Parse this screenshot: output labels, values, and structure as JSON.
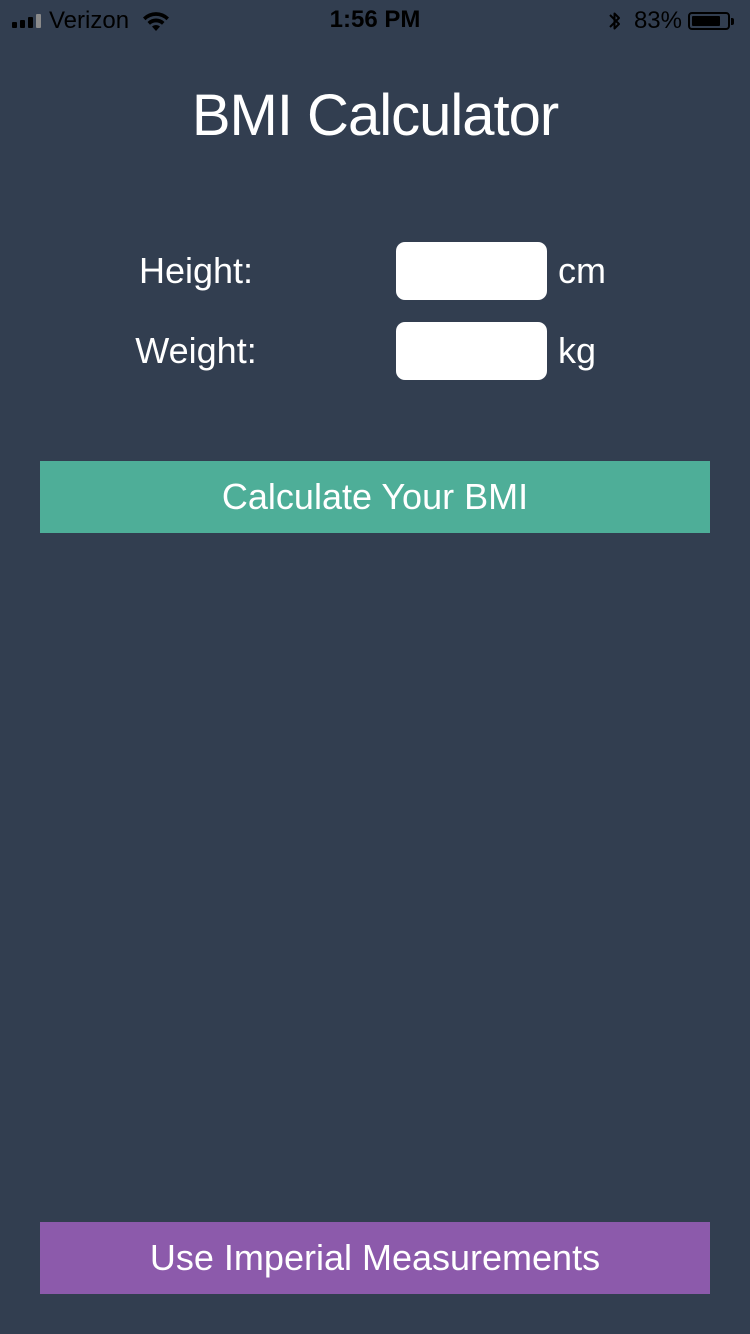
{
  "status_bar": {
    "carrier": "Verizon",
    "time": "1:56 PM",
    "battery_percent": "83%",
    "battery_level": 0.83,
    "icons": [
      "signal-icon",
      "wifi-icon",
      "bluetooth-icon",
      "battery-icon"
    ]
  },
  "app": {
    "title": "BMI Calculator"
  },
  "form": {
    "height": {
      "label": "Height:",
      "value": "",
      "placeholder": "",
      "unit": "cm"
    },
    "weight": {
      "label": "Weight:",
      "value": "",
      "placeholder": "",
      "unit": "kg"
    }
  },
  "buttons": {
    "calculate_label": "Calculate Your BMI",
    "imperial_label": "Use Imperial Measurements"
  },
  "colors": {
    "background": "#323e50",
    "calculate_button": "#4eae98",
    "imperial_button": "#8c5aab",
    "text": "#ffffff"
  }
}
